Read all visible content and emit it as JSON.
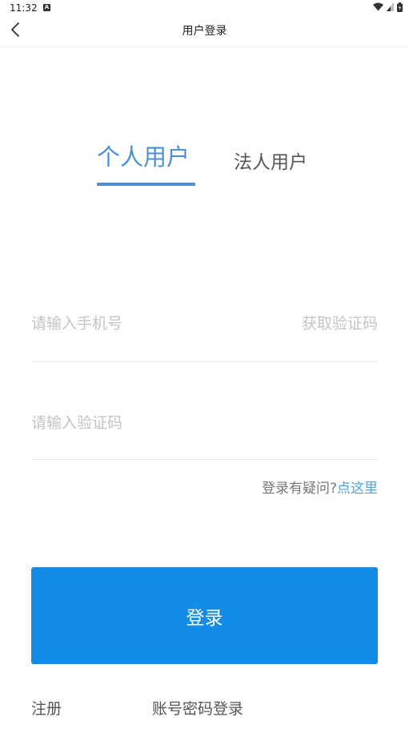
{
  "status_bar": {
    "time": "11:32",
    "notification_icon": "a-notification-icon",
    "wifi_icon": "wifi-icon",
    "signal_icon": "signal-icon",
    "battery_icon": "battery-icon"
  },
  "header": {
    "back_icon": "chevron-left-icon",
    "title": "用户登录"
  },
  "tabs": [
    {
      "label": "个人用户",
      "active": true
    },
    {
      "label": "法人用户",
      "active": false
    }
  ],
  "form": {
    "phone": {
      "value": "",
      "placeholder": "请输入手机号"
    },
    "get_code_label": "获取验证码",
    "code": {
      "value": "",
      "placeholder": "请输入验证码"
    }
  },
  "help": {
    "text": "登录有疑问?",
    "link": "点这里"
  },
  "login_button": "登录",
  "footer": {
    "register": "注册",
    "password_login": "账号密码登录"
  },
  "colors": {
    "accent": "#4a90d9",
    "button": "#138ce8",
    "link": "#4aa3e8",
    "placeholder": "#c4c4c4"
  }
}
